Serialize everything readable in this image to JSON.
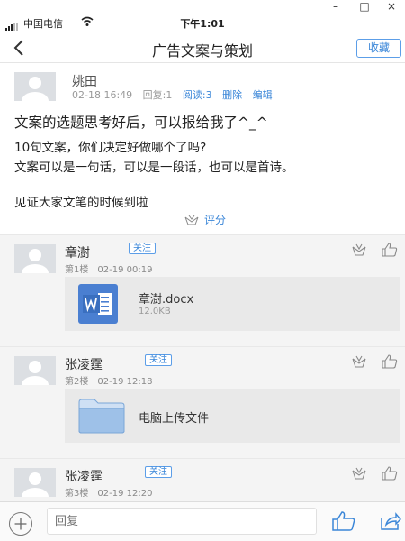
{
  "window": {
    "minimize": "–",
    "maximize": "□",
    "close": "×"
  },
  "status": {
    "carrier": "中国电信",
    "time": "下午1:01"
  },
  "nav": {
    "title": "广告文案与策划",
    "collect": "收藏"
  },
  "post": {
    "author": "姚田",
    "date": "02-18 16:49",
    "reply": "回复:1",
    "read": "阅读:3",
    "delete": "删除",
    "edit": "编辑",
    "lines": [
      "文案的选题思考好后，可以报给我了^_^",
      "10句文案，你们决定好做哪个了吗?",
      "文案可以是一句话，可以是一段话，也可以是首诗。",
      "见证大家文笔的时候到啦"
    ],
    "rate": "评分"
  },
  "replies": [
    {
      "name": "章澍",
      "follow": "关注",
      "floor": "第1楼",
      "time": "02-19 00:19",
      "file": "章澍.docx",
      "size": "12.0KB",
      "file_type": "word-doc"
    },
    {
      "name": "张凌霆",
      "follow": "关注",
      "floor": "第2楼",
      "time": "02-19 12:18",
      "file": "电脑上传文件",
      "file_type": "folder"
    },
    {
      "name": "张凌霆",
      "follow": "关注",
      "floor": "第3楼",
      "time": "02-19 12:20"
    }
  ],
  "composer": {
    "placeholder": "回复"
  },
  "colors": {
    "accent": "#3a86d8",
    "word": "#4a7fd1",
    "folder": "#9ec1e8"
  },
  "icons": [
    "back-icon",
    "wifi-icon",
    "rate-icon",
    "add-icon",
    "like-icon",
    "share-icon",
    "word-file-icon",
    "folder-icon"
  ]
}
